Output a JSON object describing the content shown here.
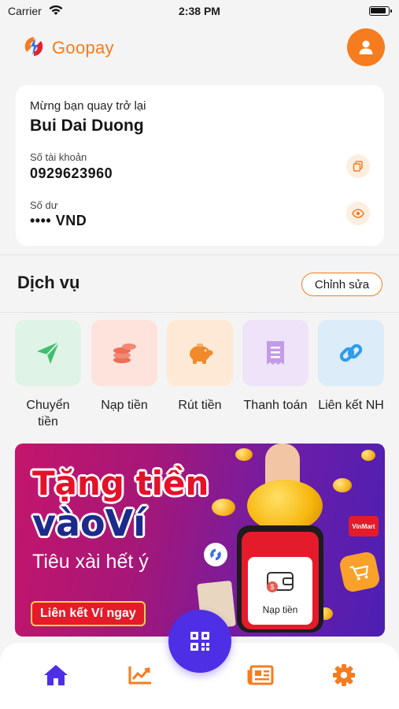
{
  "status_bar": {
    "carrier": "Carrier",
    "time": "2:38 PM"
  },
  "header": {
    "brand": "Goopay",
    "accent_color": "#f57c1f"
  },
  "account": {
    "welcome": "Mừng bạn quay trở lại",
    "name": "Bui Dai Duong",
    "account_label": "Số tài khoản",
    "account_number": "0929623960",
    "balance_label": "Số dư",
    "balance_value": "•••• VND"
  },
  "services": {
    "title": "Dịch vụ",
    "edit_label": "Chỉnh sửa",
    "items": [
      {
        "label": "Chuyển tiền",
        "icon": "send-icon",
        "bg": "#dff3e6",
        "color": "#3fbf6e"
      },
      {
        "label": "Nạp tiền",
        "icon": "coins-icon",
        "bg": "#fde3dc",
        "color": "#ee6d55"
      },
      {
        "label": "Rút tiền",
        "icon": "piggy-bank-icon",
        "bg": "#fde9d6",
        "color": "#f08a2a"
      },
      {
        "label": "Thanh toán",
        "icon": "receipt-icon",
        "bg": "#eee3f8",
        "color": "#b07de0"
      },
      {
        "label": "Liên kết NH",
        "icon": "link-icon",
        "bg": "#dcecf8",
        "color": "#2f9de6"
      }
    ]
  },
  "banner": {
    "title_line1": "Tặng tiền",
    "title_line2": "vàoVí",
    "subtitle": "Tiêu xài hết ý",
    "cta": "Liên kết Ví ngay",
    "phone_label": "Nạp tiền",
    "store_badge": "VinMart"
  },
  "tabbar": {
    "items": [
      "home-icon",
      "chart-icon",
      "qr-code-icon",
      "news-icon",
      "gear-icon"
    ],
    "active_color": "#4f2fe6",
    "inactive_color": "#f57c1f"
  }
}
